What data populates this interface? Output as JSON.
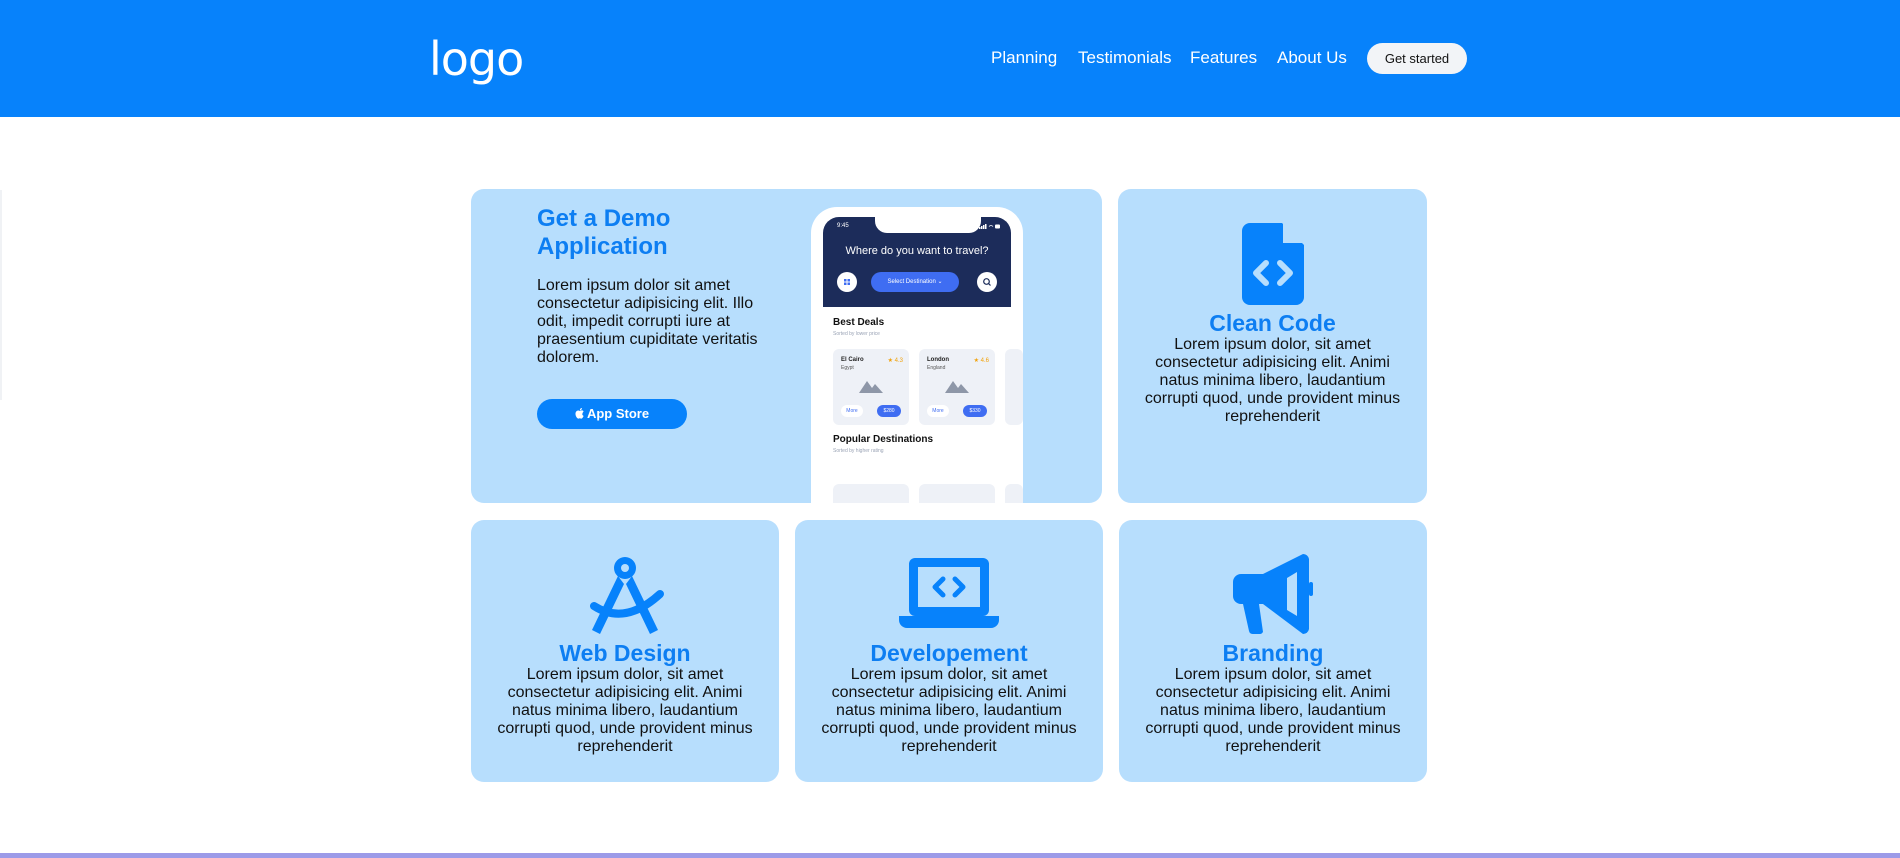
{
  "header": {
    "logo": "logo",
    "nav": [
      {
        "label": "Planning"
      },
      {
        "label": "Testimonials"
      },
      {
        "label": "Features"
      },
      {
        "label": "About Us"
      }
    ],
    "cta_label": "Get started"
  },
  "colors": {
    "brand_blue": "#0782fb",
    "card_bg": "#b7defd",
    "title_blue": "#0d7ef2"
  },
  "demo": {
    "title": "Get a Demo Application",
    "text": "Lorem ipsum dolor sit amet consectetur adipisicing elit. Illo odit, impedit corrupti iure at praesentium cupiditate veritatis dolorem.",
    "button_label": "App Store",
    "button_icon": "apple-icon",
    "phone": {
      "time": "9:45",
      "headline": "Where do you want to travel?",
      "select_label": "Select Destination",
      "best_deals_title": "Best Deals",
      "best_deals_sub": "Sorted by lower price",
      "deals": [
        {
          "city": "El Cairo",
          "country": "Egypt",
          "rating": "★ 4.3",
          "more": "More",
          "price": "$280"
        },
        {
          "city": "London",
          "country": "England",
          "rating": "★ 4.6",
          "more": "More",
          "price": "$330"
        }
      ],
      "popular_title": "Popular Destinations",
      "popular_sub": "Sorted by higher rating"
    }
  },
  "features": [
    {
      "icon": "code-file-icon",
      "title": "Clean Code",
      "text": "Lorem ipsum dolor, sit amet consectetur adipisicing elit. Animi natus minima libero, laudantium corrupti quod, unde provident minus reprehenderit"
    },
    {
      "icon": "compass-drawing-icon",
      "title": "Web Design",
      "text": "Lorem ipsum dolor, sit amet consectetur adipisicing elit. Animi natus minima libero, laudantium corrupti quod, unde provident minus reprehenderit"
    },
    {
      "icon": "laptop-code-icon",
      "title": "Developement",
      "text": "Lorem ipsum dolor, sit amet consectetur adipisicing elit. Animi natus minima libero, laudantium corrupti quod, unde provident minus reprehenderit"
    },
    {
      "icon": "megaphone-icon",
      "title": "Branding",
      "text": "Lorem ipsum dolor, sit amet consectetur adipisicing elit. Animi natus minima libero, laudantium corrupti quod, unde provident minus reprehenderit"
    }
  ]
}
